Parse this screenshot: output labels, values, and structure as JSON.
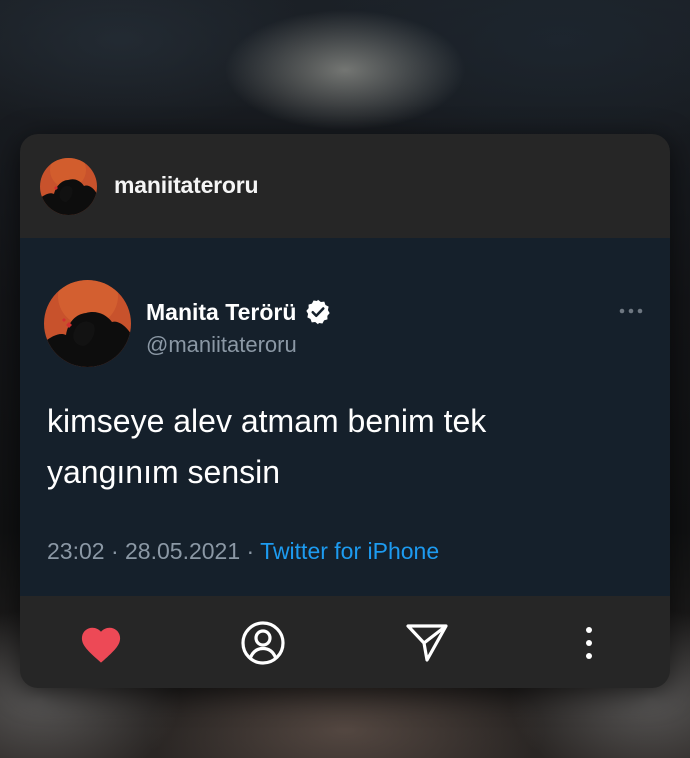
{
  "post": {
    "username": "maniitateroru"
  },
  "tweet": {
    "display_name": "Manita Terörü",
    "handle": "@maniitateroru",
    "text_line1": "kimseye alev atmam benim tek",
    "text_line2": "yangınım sensin",
    "time": "23:02",
    "separator": " · ",
    "date": "28.05.2021",
    "source": "Twitter for iPhone",
    "verified": true
  },
  "actions": [
    "heart-icon",
    "profile-icon",
    "send-icon",
    "more-vertical-icon"
  ],
  "colors": {
    "card": "#262626",
    "tweet_bg": "#15202b",
    "link": "#1d9bf0",
    "heart": "#ed4956",
    "muted": "#8b98a5"
  }
}
